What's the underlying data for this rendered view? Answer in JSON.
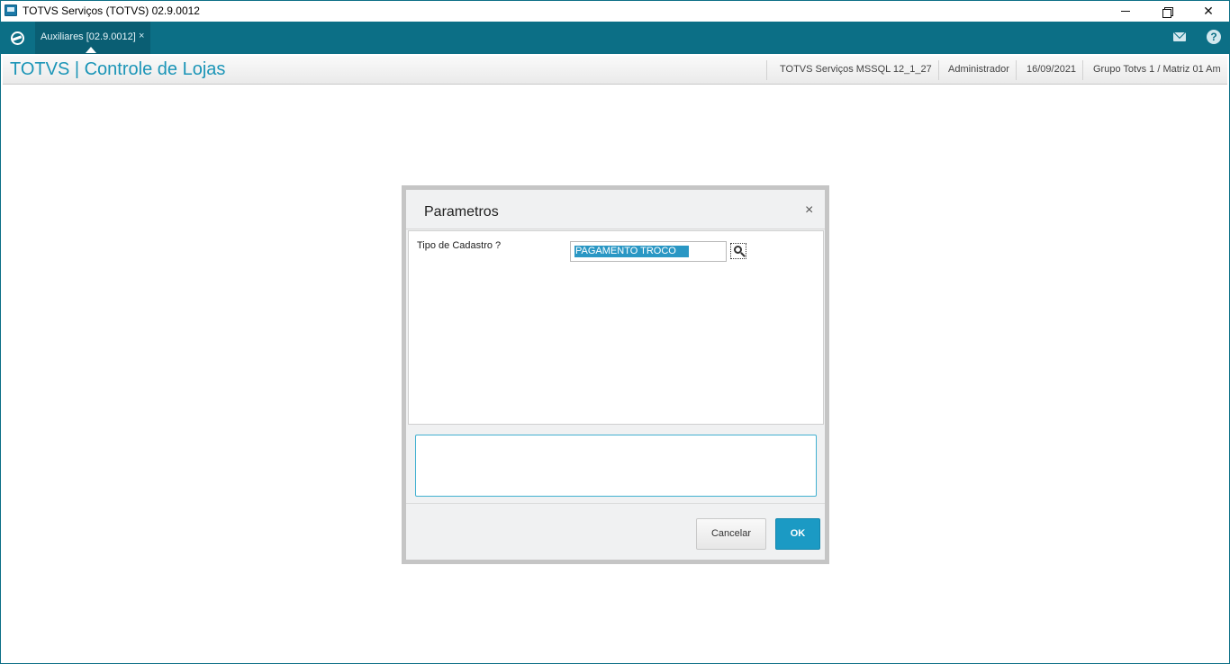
{
  "window": {
    "title": "TOTVS Serviços (TOTVS) 02.9.0012",
    "icons": [
      "app-icon",
      "minimize-icon",
      "maximize-icon",
      "close-icon"
    ]
  },
  "tabbar": {
    "logo_icon": "totvs-logo-icon",
    "tabs": [
      {
        "label": "Auxiliares [02.9.0012]",
        "close_glyph": "×",
        "active": true
      }
    ],
    "mail_icon": "mail-icon",
    "help_icon": "help-icon",
    "help_glyph": "?",
    "accent_color": "#0c6f86"
  },
  "header": {
    "module_title": "TOTVS | Controle de Lojas",
    "environment": "TOTVS Serviços MSSQL 12_1_27",
    "user": "Administrador",
    "date": "16/09/2021",
    "branch": "Grupo Totvs 1 / Matriz 01 Am"
  },
  "dialog": {
    "title": "Parametros",
    "close_glyph": "×",
    "params": [
      {
        "label": "Tipo de Cadastro ?",
        "value": "PAGAMENTO TROCO",
        "lookup_icon": "search-icon"
      }
    ],
    "help_text": "",
    "buttons": {
      "cancel_label": "Cancelar",
      "ok_label": "OK"
    },
    "ok_color": "#1b9ac4"
  }
}
